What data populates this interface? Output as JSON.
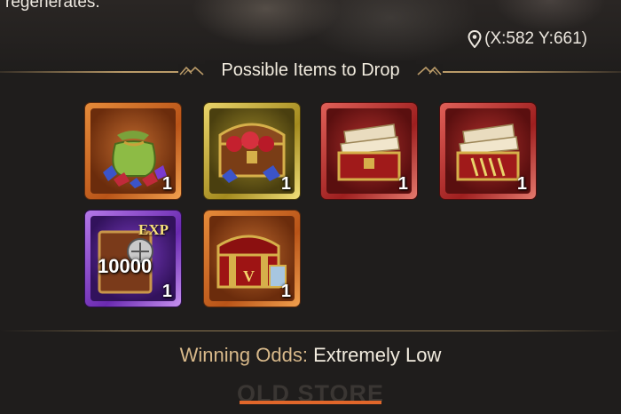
{
  "header": {
    "description_tail": "regenerates.",
    "coordinates": "(X:582 Y:661)"
  },
  "section": {
    "title": "Possible Items to Drop"
  },
  "items": [
    {
      "icon": "gem-sack-icon",
      "rarity_color": "#e58b3a",
      "quantity": "1"
    },
    {
      "icon": "gem-treasure-chest-icon",
      "rarity_color": "#e9d46a",
      "quantity": "1"
    },
    {
      "icon": "scroll-chest-icon",
      "rarity_color": "#e06058",
      "quantity": "1"
    },
    {
      "icon": "scroll-chest-icon-2",
      "rarity_color": "#e06058",
      "quantity": "1"
    },
    {
      "icon": "exp-book-icon",
      "rarity_color": "#b478e8",
      "label": "EXP",
      "amount": "10000",
      "quantity": "1"
    },
    {
      "icon": "roman-v-chest-icon",
      "rarity_color": "#e58b3a",
      "label": "V",
      "quantity": "1"
    }
  ],
  "odds": {
    "label": "Winning Odds:",
    "value": "Extremely Low"
  },
  "footer": {
    "tab_label": "OLD STORE",
    "accent_color": "#e0662a"
  }
}
